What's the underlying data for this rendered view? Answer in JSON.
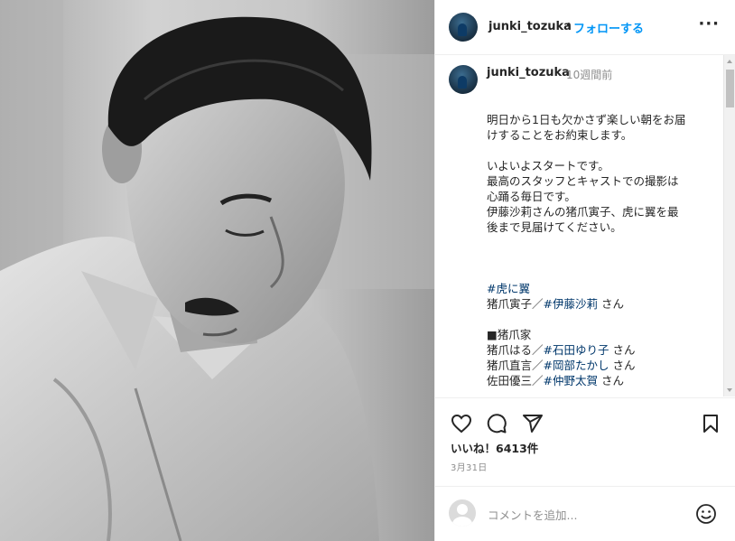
{
  "header": {
    "username": "junki_tozuka",
    "separator": "•",
    "follow_label": "フォローする",
    "more_label": "···"
  },
  "post": {
    "username": "junki_tozuka",
    "time": "10週間前",
    "caption": {
      "l1": "明日から1日も欠かさず楽しい朝をお届",
      "l2": "けすることをお約束します。",
      "l3": "いよいよスタートです。",
      "l4": "最高のスタッフとキャストでの撮影は",
      "l5": "心踊る毎日です。",
      "l6": "伊藤沙莉さんの猪爪寅子、虎に翼を最",
      "l7": "後まで見届けてください。",
      "hashtag1": "#虎に翼",
      "l8_prefix": "猪爪寅子／",
      "l8_tag": "#伊藤沙莉",
      "l8_suffix": " さん",
      "l9": "■猪爪家",
      "l10_prefix": "猪爪はる／",
      "l10_tag": "#石田ゆり子",
      "l10_suffix": " さん",
      "l11_prefix": "猪爪直言／",
      "l11_tag": "#岡部たかし",
      "l11_suffix": " さん",
      "l12_prefix": "佐田優三／",
      "l12_tag": "#仲野太賀",
      "l12_suffix": " さん"
    }
  },
  "stats": {
    "likes": "いいね！6413件",
    "date": "3月31日"
  },
  "comment_input": {
    "placeholder": "コメントを追加..."
  },
  "icons": {
    "like": "heart-icon",
    "comment": "comment-icon",
    "share": "send-icon",
    "save": "bookmark-icon",
    "emoji": "emoji-icon"
  },
  "colors": {
    "link": "#0095f6",
    "hashtag": "#00376b",
    "muted": "#8e8e8e"
  }
}
